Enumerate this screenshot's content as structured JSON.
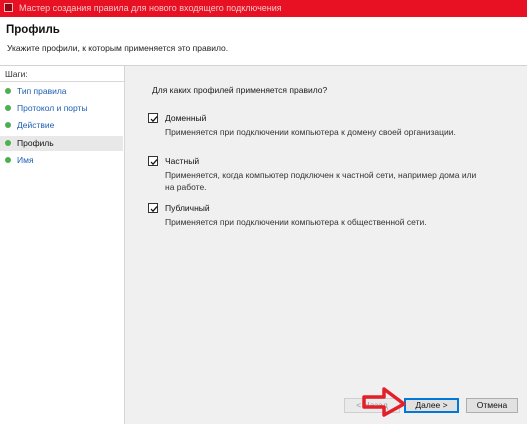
{
  "window": {
    "title": "Мастер создания правила для нового входящего подключения"
  },
  "header": {
    "title": "Профиль",
    "subtitle": "Укажите профили, к которым применяется это правило."
  },
  "sidebar": {
    "steps_label": "Шаги:",
    "steps": [
      {
        "label": "Тип правила",
        "active": false
      },
      {
        "label": "Протокол и порты",
        "active": false
      },
      {
        "label": "Действие",
        "active": false
      },
      {
        "label": "Профиль",
        "active": true
      },
      {
        "label": "Имя",
        "active": false
      }
    ]
  },
  "main": {
    "question": "Для каких профилей применяется правило?",
    "profiles": [
      {
        "name": "Доменный",
        "checked": true,
        "description": "Применяется при подключении компьютера к домену своей организации."
      },
      {
        "name": "Частный",
        "checked": true,
        "description": "Применяется, когда компьютер подключен к частной сети, например дома или на работе."
      },
      {
        "name": "Публичный",
        "checked": true,
        "description": "Применяется при подключении компьютера к общественной сети."
      }
    ]
  },
  "buttons": {
    "back": "< Назад",
    "next": "Далее >",
    "cancel": "Отмена"
  },
  "colors": {
    "titlebar": "#e81123",
    "annotation_arrow": "#e3202a",
    "step_dot": "#4caf50",
    "link": "#1e5fb4"
  }
}
